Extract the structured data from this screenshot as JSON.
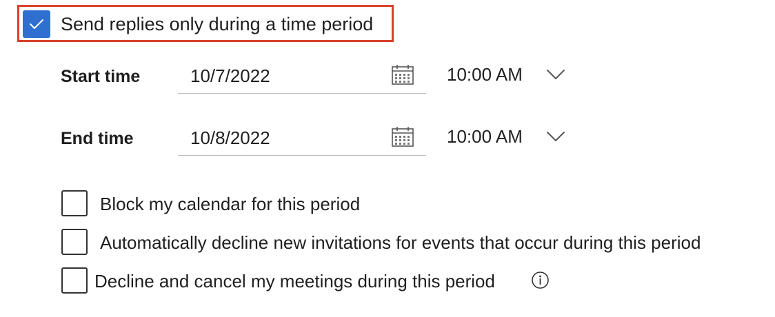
{
  "auto_reply": {
    "send_during_period": {
      "label": "Send replies only during a time period",
      "checked": true
    },
    "start": {
      "label": "Start time",
      "date": "10/7/2022",
      "time": "10:00 AM"
    },
    "end": {
      "label": "End time",
      "date": "10/8/2022",
      "time": "10:00 AM"
    },
    "options": [
      {
        "label": "Block my calendar for this period",
        "checked": false
      },
      {
        "label": "Automatically decline new invitations for events that occur during this period",
        "checked": false
      },
      {
        "label": "Decline and cancel my meetings during this period",
        "checked": false
      }
    ]
  },
  "colors": {
    "checkbox_accent": "#2f6fcf",
    "highlight_border": "#d9412b"
  },
  "icons": {
    "calendar": "calendar-icon",
    "chevron": "chevron-down-icon",
    "info": "info-icon",
    "check": "checkmark-icon"
  }
}
